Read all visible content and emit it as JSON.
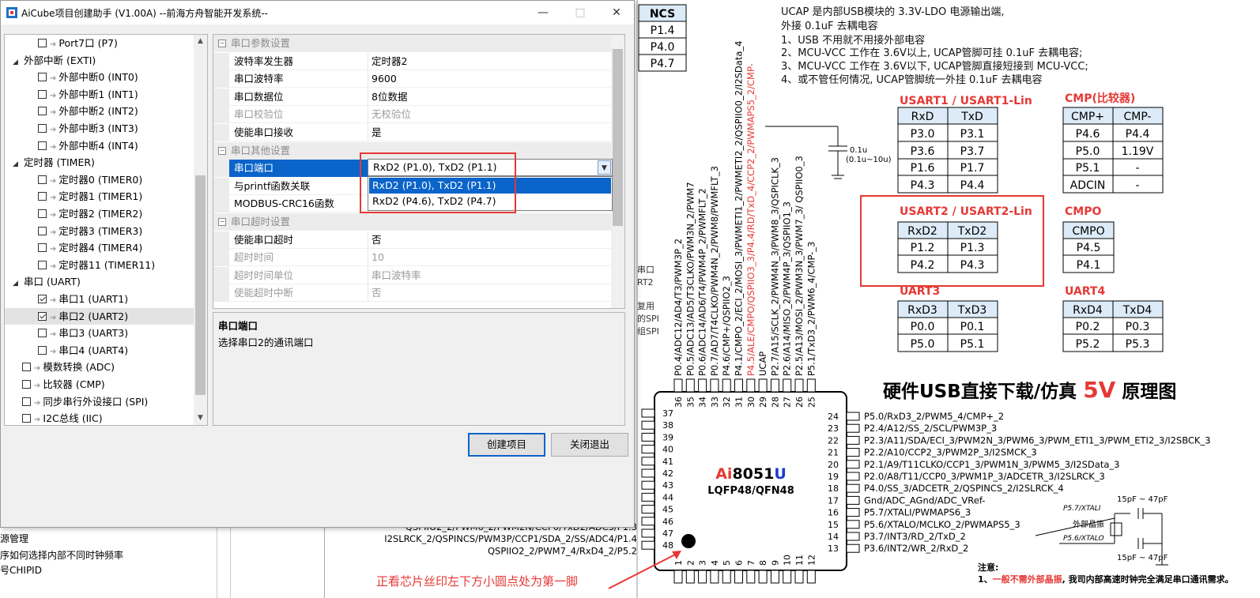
{
  "window": {
    "title": "AiCube项目创建助手 (V1.00A) --前海方舟智能开发系统--",
    "minimize": "—",
    "maximize": "□",
    "close": "✕"
  },
  "tree": {
    "items": [
      {
        "label": "Port7口 (P7)",
        "level": 2,
        "checked": false
      },
      {
        "label": "外部中断 (EXTI)",
        "level": 1,
        "group": true
      },
      {
        "label": "外部中断0 (INT0)",
        "level": 2,
        "checked": false
      },
      {
        "label": "外部中断1 (INT1)",
        "level": 2,
        "checked": false
      },
      {
        "label": "外部中断2 (INT2)",
        "level": 2,
        "checked": false
      },
      {
        "label": "外部中断3 (INT3)",
        "level": 2,
        "checked": false
      },
      {
        "label": "外部中断4 (INT4)",
        "level": 2,
        "checked": false
      },
      {
        "label": "定时器 (TIMER)",
        "level": 1,
        "group": true
      },
      {
        "label": "定时器0 (TIMER0)",
        "level": 2,
        "checked": false
      },
      {
        "label": "定时器1 (TIMER1)",
        "level": 2,
        "checked": false
      },
      {
        "label": "定时器2 (TIMER2)",
        "level": 2,
        "checked": false
      },
      {
        "label": "定时器3 (TIMER3)",
        "level": 2,
        "checked": false
      },
      {
        "label": "定时器4 (TIMER4)",
        "level": 2,
        "checked": false
      },
      {
        "label": "定时器11 (TIMER11)",
        "level": 2,
        "checked": false
      },
      {
        "label": "串口 (UART)",
        "level": 1,
        "group": true
      },
      {
        "label": "串口1 (UART1)",
        "level": 2,
        "checked": true
      },
      {
        "label": "串口2 (UART2)",
        "level": 2,
        "checked": true,
        "selected": true
      },
      {
        "label": "串口3 (UART3)",
        "level": 2,
        "checked": false
      },
      {
        "label": "串口4 (UART4)",
        "level": 2,
        "checked": false
      },
      {
        "label": "模数转换 (ADC)",
        "level": 1,
        "checked": false
      },
      {
        "label": "比较器 (CMP)",
        "level": 1,
        "checked": false
      },
      {
        "label": "同步串行外设接口 (SPI)",
        "level": 1,
        "checked": false
      },
      {
        "label": "I2C总线 (IIC)",
        "level": 1,
        "checked": false
      }
    ]
  },
  "props": {
    "rows": [
      {
        "type": "cat",
        "k": "串口参数设置"
      },
      {
        "k": "波特率发生器",
        "v": "定时器2"
      },
      {
        "k": "串口波特率",
        "v": "9600"
      },
      {
        "k": "串口数据位",
        "v": "8位数据"
      },
      {
        "k": "串口校验位",
        "v": "无校验位",
        "disabled": true
      },
      {
        "k": "使能串口接收",
        "v": "是"
      },
      {
        "type": "cat",
        "k": "串口其他设置"
      },
      {
        "k": "串口端口",
        "v": "",
        "selected": true
      },
      {
        "k": "与printf函数关联",
        "v": ""
      },
      {
        "k": "MODBUS-CRC16函数",
        "v": ""
      },
      {
        "type": "cat",
        "k": "串口超时设置"
      },
      {
        "k": "使能串口超时",
        "v": "否"
      },
      {
        "k": "超时时间",
        "v": "10",
        "disabled": true
      },
      {
        "k": "超时时间单位",
        "v": "串口波特率",
        "disabled": true
      },
      {
        "k": "使能超时中断",
        "v": "否",
        "disabled": true
      }
    ],
    "combo_value": "RxD2 (P1.0), TxD2 (P1.1)",
    "options": [
      "RxD2 (P1.0), TxD2 (P1.1)",
      "RxD2 (P4.6), TxD2 (P4.7)"
    ]
  },
  "desc": {
    "title": "串口端口",
    "text": "选择串口2的通讯端口"
  },
  "buttons": {
    "create": "创建项目",
    "exit": "关闭退出"
  },
  "background": {
    "left_lines": [
      "源管理",
      "序如何选择内部不同时钟频率",
      "号CHIPID"
    ],
    "side_frags": [
      "串口",
      "RT2",
      "复用",
      "的SPI",
      "组SPI"
    ],
    "ncs_table": [
      "NCS",
      "P1.4",
      "P4.0",
      "P4.7"
    ],
    "ucap_notes": [
      "UCAP 是内部USB模块的 3.3V-LDO 电源输出端,",
      "外接 0.1uF 去耦电容",
      "1、USB 不用就不用接外部电容",
      "2、MCU-VCC 工作在 3.6V以上, UCAP管脚可挂 0.1uF 去耦电容;",
      "3、MCU-VCC 工作在 3.6V以下, UCAP管脚直接短接到 MCU-VCC;",
      "4、或不管任何情况, UCAP管脚统一外挂 0.1uF 去耦电容"
    ],
    "cap_labels": [
      "0.1u",
      "(0.1u~10u)"
    ],
    "usart1": {
      "title": "USART1 / USART1-Lin",
      "head": [
        "RxD",
        "TxD"
      ],
      "rows": [
        [
          "P3.0",
          "P3.1"
        ],
        [
          "P3.6",
          "P3.7"
        ],
        [
          "P1.6",
          "P1.7"
        ],
        [
          "P4.3",
          "P4.4"
        ]
      ]
    },
    "cmp": {
      "title": "CMP(比较器)",
      "head": [
        "CMP+",
        "CMP-"
      ],
      "rows": [
        [
          "P4.6",
          "P4.4"
        ],
        [
          "P5.0",
          "1.19V"
        ],
        [
          "P5.1",
          "-"
        ],
        [
          "ADCIN",
          "-"
        ]
      ]
    },
    "usart2": {
      "title": "USART2 / USART2-Lin",
      "head": [
        "RxD2",
        "TxD2"
      ],
      "rows": [
        [
          "P1.2",
          "P1.3"
        ],
        [
          "P4.2",
          "P4.3"
        ]
      ]
    },
    "cmpo": {
      "title": "CMPO",
      "head": [
        "CMPO"
      ],
      "rows": [
        [
          "P4.5"
        ],
        [
          "P4.1"
        ]
      ]
    },
    "uart3": {
      "title": "UART3",
      "head": [
        "RxD3",
        "TxD3"
      ],
      "rows": [
        [
          "P0.0",
          "P0.1"
        ],
        [
          "P5.0",
          "P5.1"
        ]
      ]
    },
    "uart4": {
      "title": "UART4",
      "head": [
        "RxD4",
        "TxD4"
      ],
      "rows": [
        [
          "P0.2",
          "P0.3"
        ],
        [
          "P5.2",
          "P5.3"
        ]
      ]
    },
    "heading_a": "硬件USB直接下载/仿真",
    "heading_b": "5V",
    "heading_c": "原理图",
    "chip_name_a": "Ai",
    "chip_name_b": "8051",
    "chip_name_c": "U",
    "chip_pkg": "LQFP48/QFN48",
    "left_pins": [
      "37",
      "38",
      "39",
      "40",
      "41",
      "42",
      "43",
      "44",
      "45",
      "46",
      "47",
      "48"
    ],
    "top_pins": [
      "36",
      "35",
      "34",
      "33",
      "32",
      "31",
      "30",
      "29",
      "28",
      "27",
      "26",
      "25"
    ],
    "bottom_pins": [
      "1",
      "2",
      "3",
      "4",
      "5",
      "6",
      "7",
      "8",
      "9",
      "10",
      "11",
      "12"
    ],
    "right_pins": [
      {
        "n": "24",
        "t": "P5.0/RxD3_2/PWM5_4/CMP+_2"
      },
      {
        "n": "23",
        "t": "P2.4/A12/SS_2/SCL/PWM3P_3"
      },
      {
        "n": "22",
        "t": "P2.3/A11/SDA/ECI_3/PWM2N_3/PWM6_3/PWM_ETI1_3/PWM_ETI2_3/I2SBCK_3"
      },
      {
        "n": "21",
        "t": "P2.2/A10/CCP2_3/PWM2P_3/I2SMCK_3"
      },
      {
        "n": "20",
        "t": "P2.1/A9/T11CLKO/CCP1_3/PWM1N_3/PWM5_3/I2SData_3"
      },
      {
        "n": "19",
        "t": "P2.0/A8/T11/CCP0_3/PWM1P_3/ADCETR_3/I2SLRCK_3"
      },
      {
        "n": "18",
        "t": "P4.0/SS_3/ADCETR_2/QSPINCS_2/I2SLRCK_4"
      },
      {
        "n": "17",
        "t": "Gnd/ADC_AGnd/ADC_VRef-"
      },
      {
        "n": "16",
        "t": "P5.7/XTALI/PWMAPS6_3"
      },
      {
        "n": "15",
        "t": "P5.6/XTALO/MCLKO_2/PWMAPS5_3"
      },
      {
        "n": "14",
        "t": "P3.7/INT3/RD_2/TxD_2"
      },
      {
        "n": "13",
        "t": "P3.6/INT2/WR_2/RxD_2"
      }
    ],
    "left_pin_texts": [
      "QSPIIO2_2/PWM6_2/PWM2N/CCP0/TxD2/ADC3/P1.3",
      "I2SLRCK_2/QSPINCS/PWM3P/CCP1/SDA_2/SS/ADC4/P1.4",
      "QSPIIO2_2/PWM7_4/RxD4_2/P5.2"
    ],
    "top_pin_texts": [
      "P0.4/ADC12/AD4/T3/PWM3P_2",
      "P0.5/ADC13/AD5/T3CLKO/PWM3N_2/PWM7",
      "P0.6/ADC14/AD6/T4/PWM4P_2/PWMFLT_2",
      "P0.7/AD7/T4CLKO/PWM4N_2/PWM8/PWMFLT_3",
      "P4.6/CMP+/QSPIIO2_3",
      "P4.1/CMPO_2/ECI_2/MOSI_3/PWMETI1_2/PWMETI2_2/QSPIIO0_2/I2SData_4",
      "P4.5/ALE/CMPO/QSPIIO3_3/P4.4/RD/TxD_4/CCP2_2/PWMAPS5_2/CMP-",
      "UCAP",
      "P2.7/A15/SCLK_2/PWM4N_3/PWM8_3/QSPICLK_3",
      "P2.6/A14/MISO_2/PWM4P_3/QSPIIO1_3",
      "P2.5/A13/MOSI_2/PWM3N_3/PWM7_3/ QSPIIO0_3",
      "P5.1/TxD3_2/PWM6_4/CMP-_3"
    ],
    "xtal_cap1": "15pF ~ 47pF",
    "xtal_cap2": "15pF ~ 47pF",
    "xtal_in": "P5.7/XTALI",
    "xtal_out": "P5.6/XTALO",
    "xtal_label": "外部晶振",
    "note_title": "注意:",
    "note_a": "1、",
    "note_b": "一般不需外部晶振",
    "note_c": ", 我司内部高速时钟完全满足串口通讯需求。",
    "pin1_note": "正看芯片丝印左下方小圆点处为第一脚"
  }
}
